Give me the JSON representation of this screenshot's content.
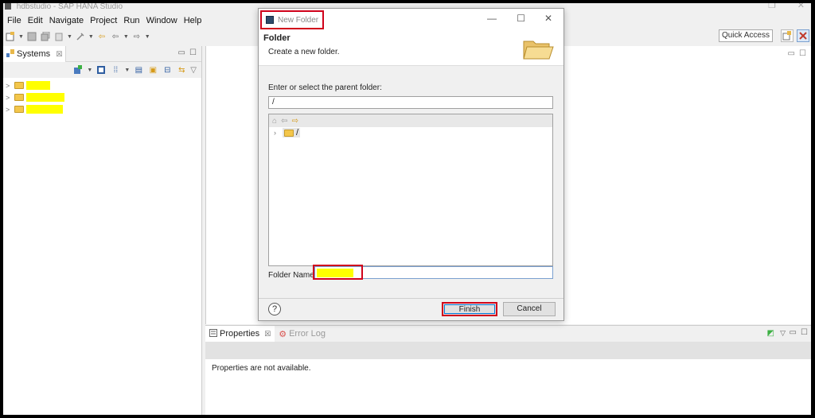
{
  "window": {
    "title": "hdbstudio - SAP HANA Studio"
  },
  "menu": [
    "File",
    "Edit",
    "Navigate",
    "Project",
    "Run",
    "Window",
    "Help"
  ],
  "toolbar": {
    "quick_access": "Quick Access"
  },
  "systems_view": {
    "tab_label": "Systems",
    "tab_close": "☒",
    "items": [
      {
        "chevron": ">",
        "name": ""
      },
      {
        "chevron": ">",
        "name": ""
      },
      {
        "chevron": ">",
        "name": ""
      }
    ]
  },
  "dialog": {
    "title": "New Folder",
    "header_title": "Folder",
    "header_subtitle": "Create a new folder.",
    "parent_label": "Enter or select the parent folder:",
    "parent_value": "/",
    "tree_root_label": "/",
    "folder_name_label": "Folder Name:",
    "folder_name_value": "",
    "help_label": "?",
    "finish_label": "Finish",
    "cancel_label": "Cancel"
  },
  "properties_view": {
    "tab_properties": "Properties",
    "tab_error_log": "Error Log",
    "message": "Properties are not available."
  },
  "colors": {
    "highlight_box": "#d0021b",
    "redaction": "#ffff00"
  }
}
